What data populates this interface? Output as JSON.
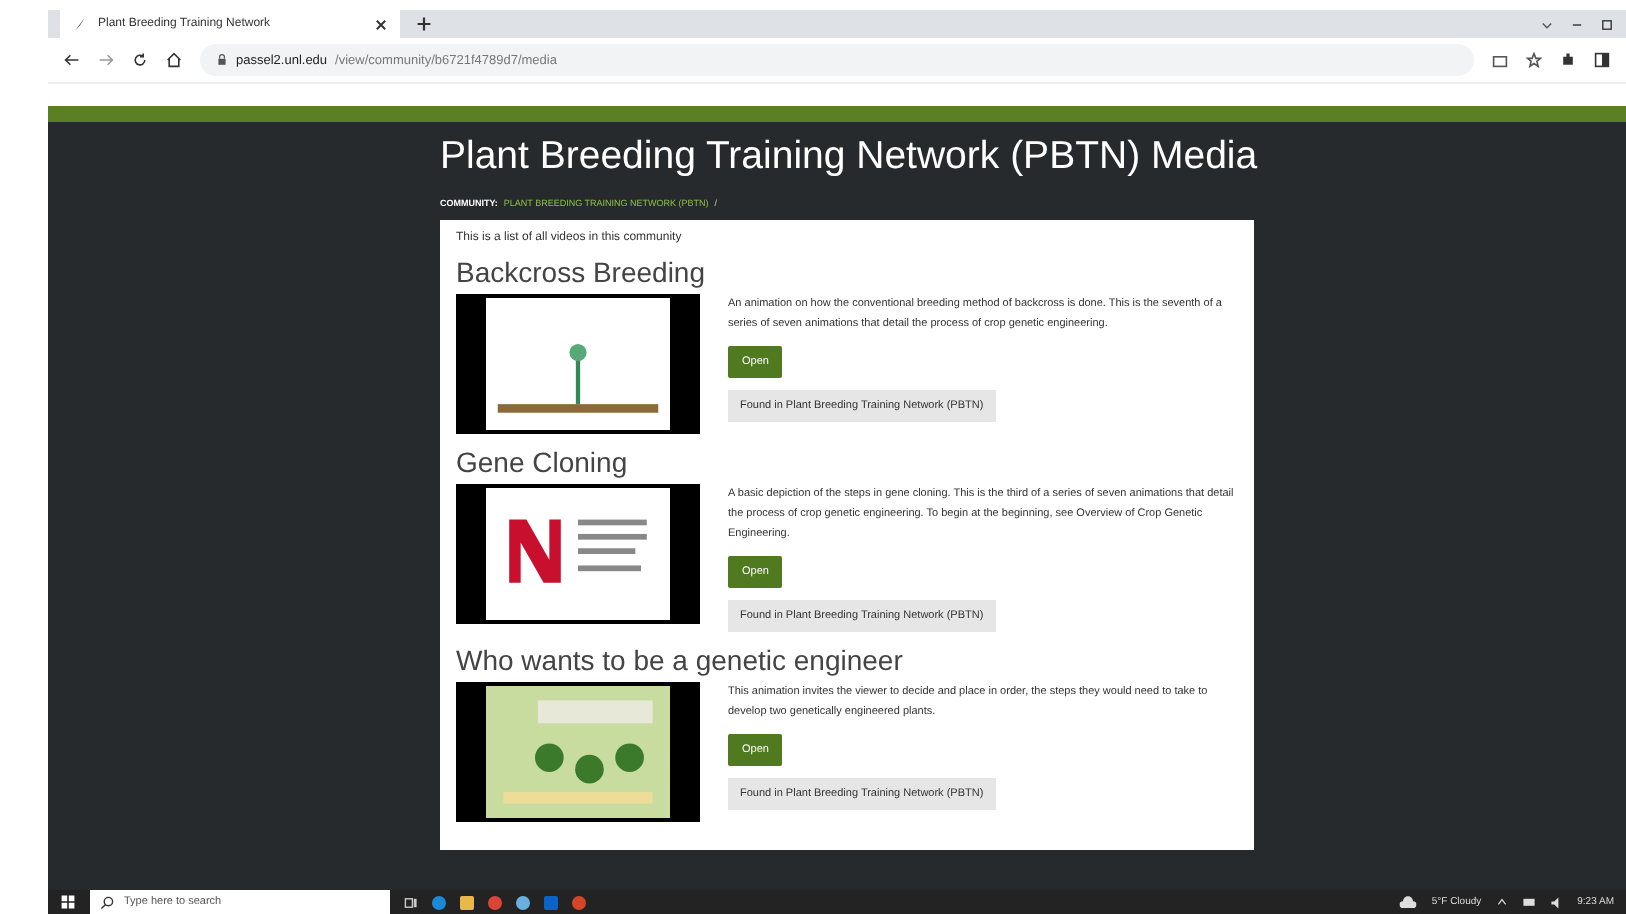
{
  "browser": {
    "tab_title": "Plant Breeding Training Network",
    "url_host": "passel2.unl.edu",
    "url_path": "/view/community/b6721f4789d7/media"
  },
  "page": {
    "title": "Plant Breeding Training Network (PBTN) Media",
    "breadcrumb_label": "COMMUNITY:",
    "breadcrumb_link": "PLANT BREEDING TRAINING NETWORK (PBTN)",
    "breadcrumb_sep": "/",
    "intro": "This is a list of all videos in this community",
    "videos": [
      {
        "title": "Backcross Breeding",
        "kind": "slide",
        "description": "An animation on how the conventional breeding method of backcross is done. This is the seventh of a series of seven animations that detail the process of crop genetic engineering.",
        "button": "Open",
        "found_in": "Found in Plant Breeding Training Network (PBTN)"
      },
      {
        "title": "Gene Cloning",
        "kind": "logo",
        "description": "A basic depiction of the steps in gene cloning. This is the third of a series of seven animations that detail the process of crop genetic engineering. To begin at the beginning, see Overview of Crop Genetic Engineering.",
        "button": "Open",
        "found_in": "Found in Plant Breeding Training Network (PBTN)"
      },
      {
        "title": "Who wants to be a genetic engineer",
        "kind": "game",
        "description": "This animation invites the viewer to decide and place in order, the steps they would need to take to develop two genetically engineered plants.",
        "button": "Open",
        "found_in": "Found in Plant Breeding Training Network (PBTN)"
      }
    ]
  },
  "taskbar": {
    "search_placeholder": "Type here to search",
    "weather": "5°F Cloudy",
    "time": "9:23 AM"
  }
}
